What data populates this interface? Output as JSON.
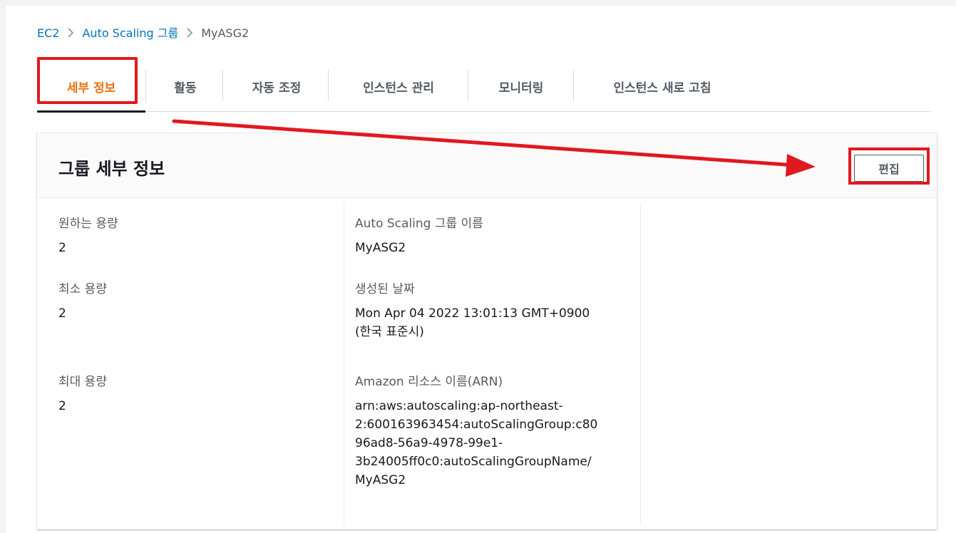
{
  "breadcrumb": {
    "items": [
      {
        "label": "EC2"
      },
      {
        "label": "Auto Scaling 그룹"
      },
      {
        "label": "MyASG2"
      }
    ]
  },
  "tabs": [
    {
      "label": "세부 정보",
      "active": true
    },
    {
      "label": "활동"
    },
    {
      "label": "자동 조정"
    },
    {
      "label": "인스턴스 관리"
    },
    {
      "label": "모니터링"
    },
    {
      "label": "인스턴스 새로 고침"
    }
  ],
  "panel": {
    "title": "그룹 세부 정보",
    "edit_label": "편집"
  },
  "details": {
    "desired_capacity": {
      "label": "원하는 용량",
      "value": "2"
    },
    "min_capacity": {
      "label": "최소 용량",
      "value": "2"
    },
    "max_capacity": {
      "label": "최대 용량",
      "value": "2"
    },
    "group_name": {
      "label": "Auto Scaling 그룹 이름",
      "value": "MyASG2"
    },
    "created_at": {
      "label": "생성된 날짜",
      "value_line1": "Mon Apr 04 2022 13:01:13 GMT+0900",
      "value_line2": "(한국 표준시)"
    },
    "arn": {
      "label": "Amazon 리소스 이름(ARN)",
      "lines": [
        "arn:aws:autoscaling:ap-northeast-",
        "2:600163963454:autoScalingGroup:c80",
        "96ad8-56a9-4978-99e1-",
        "3b24005ff0c0:autoScalingGroupName/",
        "MyASG2"
      ]
    }
  },
  "colors": {
    "link": "#0073bb",
    "active_tab": "#ec7211",
    "annotation_red": "#e0191f"
  }
}
